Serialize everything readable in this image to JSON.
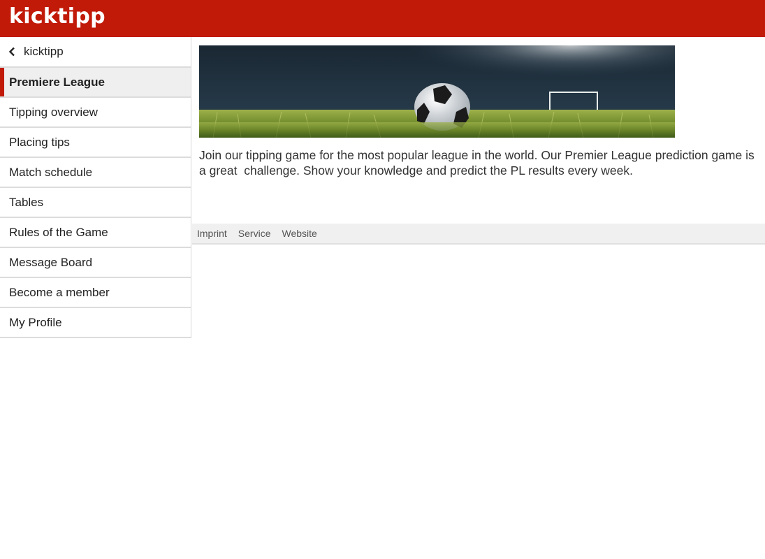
{
  "header": {
    "logo_text": "kicktipp",
    "brand_color": "#c11a08"
  },
  "sidebar": {
    "back": {
      "icon": "chevron-left-icon",
      "label": "kicktipp"
    },
    "items": [
      {
        "label": "Premiere League",
        "active": true
      },
      {
        "label": "Tipping overview",
        "active": false
      },
      {
        "label": "Placing tips",
        "active": false
      },
      {
        "label": "Match schedule",
        "active": false
      },
      {
        "label": "Tables",
        "active": false
      },
      {
        "label": "Rules of the Game",
        "active": false
      },
      {
        "label": "Message Board",
        "active": false
      },
      {
        "label": "Become a member",
        "active": false
      },
      {
        "label": "My Profile",
        "active": false
      }
    ]
  },
  "main": {
    "banner": {
      "alt": "Soccer ball on grass with goal in background"
    },
    "intro_text": "Join our tipping game for the most popular league in the world. Our Premier League prediction game is a great  challenge. Show your knowledge and predict the PL results every week.",
    "footer_links": [
      "Imprint",
      "Service",
      "Website"
    ]
  }
}
